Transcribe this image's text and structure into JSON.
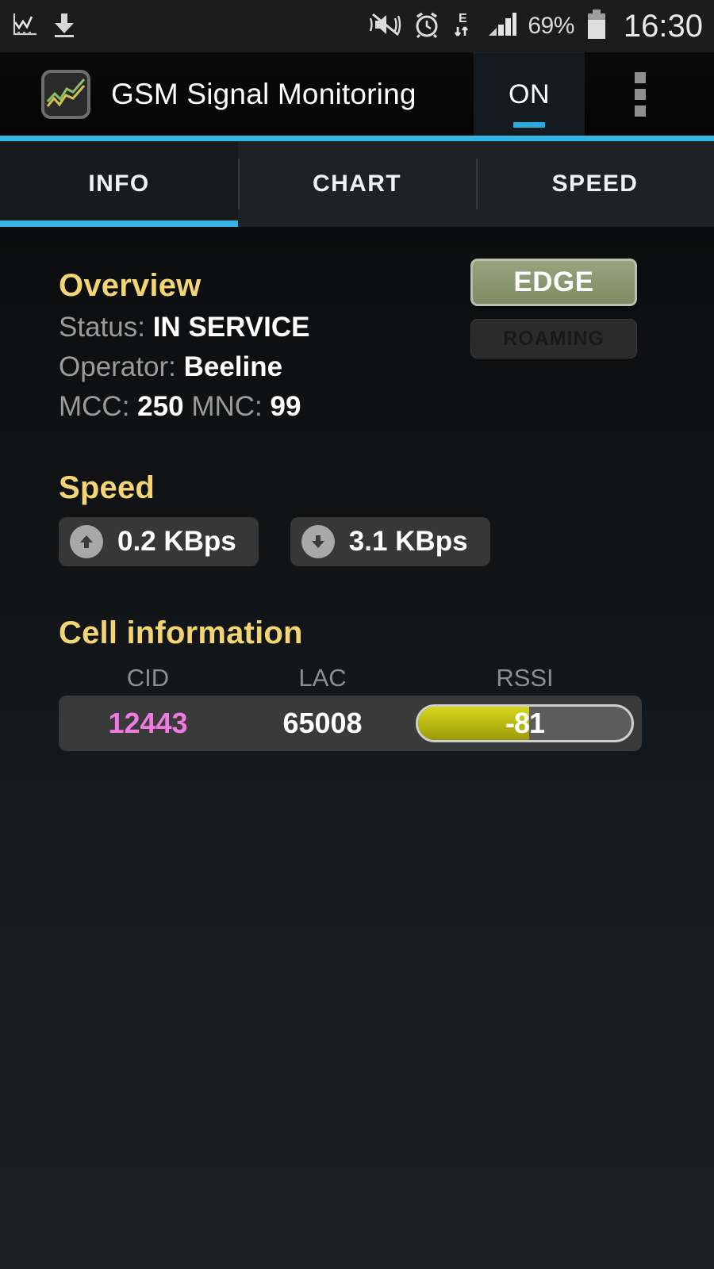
{
  "statusbar": {
    "left_icons": [
      "chart-notification-icon",
      "download-icon"
    ],
    "right_icons": [
      "mute-vibrate-icon",
      "alarm-clock-icon",
      "edge-data-icon",
      "signal-bars-icon"
    ],
    "battery_percent": "69%",
    "time": "16:30"
  },
  "actionbar": {
    "app_icon": "app-chart-icon",
    "title": "GSM Signal Monitoring",
    "toggle_label": "ON",
    "overflow_icon": "overflow-menu-icon"
  },
  "tabs": [
    {
      "label": "INFO",
      "active": true
    },
    {
      "label": "CHART",
      "active": false
    },
    {
      "label": "SPEED",
      "active": false
    }
  ],
  "overview": {
    "heading": "Overview",
    "status_label": "Status:",
    "status_value": "IN SERVICE",
    "operator_label": "Operator:",
    "operator_value": "Beeline",
    "mcc_label": "MCC:",
    "mcc_value": "250",
    "mnc_label": "MNC:",
    "mnc_value": "99",
    "network_badge": "EDGE",
    "roaming_badge": "ROAMING"
  },
  "speed": {
    "heading": "Speed",
    "upload_icon": "arrow-up-icon",
    "upload_value": "0.2 KBps",
    "download_icon": "arrow-down-icon",
    "download_value": "3.1 KBps"
  },
  "cell": {
    "heading": "Cell information",
    "columns": [
      "CID",
      "LAC",
      "RSSI"
    ],
    "cid": "12443",
    "lac": "65008",
    "rssi": "-81",
    "rssi_fill_percent": 52
  },
  "colors": {
    "accent_blue": "#33b5e5",
    "heading_yellow": "#f3d574",
    "cid_magenta": "#ef7ae0",
    "rssi_yellow": "#d8d81e",
    "edge_green": "#8c9a73"
  }
}
